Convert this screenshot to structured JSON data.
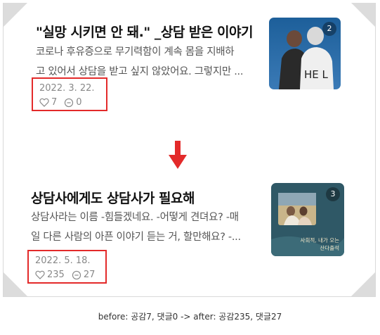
{
  "posts": [
    {
      "title": "\"실망 시키면 안 돼.\" _상담 받은 이야기",
      "excerpt_lines": [
        "코로나 후유증으로 무기력함이 계속 몸을 지배하",
        "고 있어서 상담을 받고 싶지 않았어요. 그렇지만 ..."
      ],
      "date": "2022. 3. 22.",
      "likes": "7",
      "comments": "0",
      "photo_count": "2"
    },
    {
      "title": "상담사에게도 상담사가 필요해",
      "excerpt_lines": [
        "상담사라는 이름 -힘들겠네요. -어떻게 견뎌요? -매",
        "일 다른 사람의 아픈 이야기 듣는 거, 할만해요? -..."
      ],
      "date": "2022. 5. 18.",
      "likes": "235",
      "comments": "27",
      "photo_count": "3",
      "thumb_caption_lines": [
        "사회적, 내가 오는",
        "산다출석"
      ]
    }
  ],
  "caption": "before: 공감7, 댓글0 -> after: 공감235, 댓글27",
  "colors": {
    "highlight": "#e32a2a",
    "meta_text": "#888888",
    "thumb_teal": "#2f5866"
  },
  "icons": {
    "like": "heart-outline-icon",
    "comment": "speech-bubble-icon",
    "transition": "down-arrow-icon"
  }
}
